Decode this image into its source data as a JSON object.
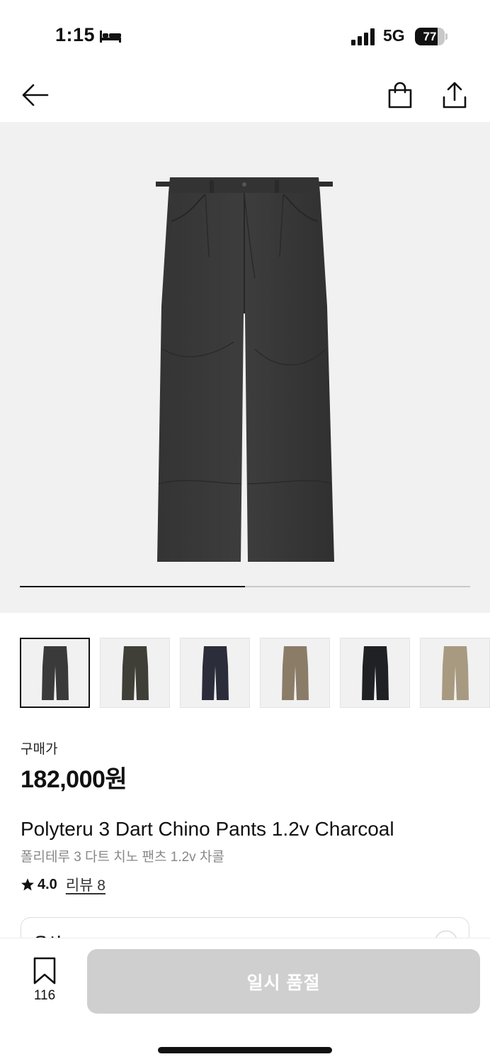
{
  "status_bar": {
    "time": "1:15",
    "network": "5G",
    "battery_level": "77",
    "battery_fraction": 0.77
  },
  "nav": {
    "back_icon": "arrow-left-icon",
    "bag_icon": "shopping-bag-icon",
    "share_icon": "share-icon"
  },
  "gallery": {
    "progress_fraction": 0.5,
    "thumbnails": [
      {
        "color": "#3a3a3a",
        "selected": true
      },
      {
        "color": "#3f3e37",
        "selected": false
      },
      {
        "color": "#2c2d3a",
        "selected": false
      },
      {
        "color": "#8b7c68",
        "selected": false
      },
      {
        "color": "#1f2124",
        "selected": false
      },
      {
        "color": "#a89a80",
        "selected": false
      }
    ]
  },
  "product": {
    "price_label": "구매가",
    "price": "182,000원",
    "name_en": "Polyteru 3 Dart Chino Pants 1.2v Charcoal",
    "name_ko": "폴리테루 3 다트 치노 팬츠 1.2v 차콜",
    "rating": "4.0",
    "review_label": "리뷰 8",
    "option_label": "옵션"
  },
  "bottom_bar": {
    "wish_count": "116",
    "soldout_label": "일시 품절"
  }
}
